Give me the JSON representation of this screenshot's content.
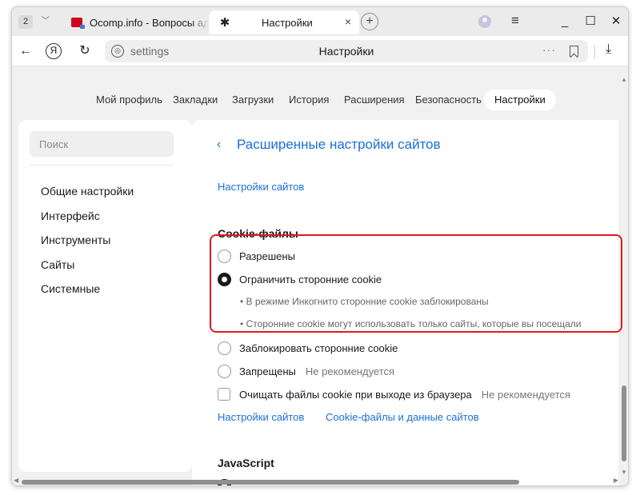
{
  "tabbar": {
    "tab_count": "2",
    "tabs": [
      {
        "title": "Ocomp.info - Вопросы адм",
        "active": false
      },
      {
        "title": "Настройки",
        "active": true
      }
    ],
    "new_tab_label": "+",
    "close_label": "×",
    "minimize_label": "_",
    "maximize_label": "☐",
    "window_close_label": "✕"
  },
  "address_bar": {
    "url": "settings",
    "page_title": "Настройки",
    "more_label": "···"
  },
  "nav_tabs": [
    "Мой профиль",
    "Закладки",
    "Загрузки",
    "История",
    "Расширения",
    "Безопасность",
    "Настройки"
  ],
  "active_nav_tab": "Настройки",
  "sidebar": {
    "search_placeholder": "Поиск",
    "items": [
      "Общие настройки",
      "Интерфейс",
      "Инструменты",
      "Сайты",
      "Системные"
    ]
  },
  "main": {
    "title": "Расширенные настройки сайтов",
    "top_link": "Настройки сайтов",
    "cookies": {
      "title": "Cookie-файлы",
      "options": [
        {
          "label": "Разрешены",
          "checked": false,
          "note": ""
        },
        {
          "label": "Ограничить сторонние cookie",
          "checked": true,
          "note": ""
        },
        {
          "label": "Заблокировать сторонние cookie",
          "checked": false,
          "note": ""
        },
        {
          "label": "Запрещены",
          "checked": false,
          "note": "Не рекомендуется"
        }
      ],
      "bullets": [
        "• В режиме Инкогнито сторонние cookie заблокированы",
        "• Сторонние cookie могут использовать только сайты, которые вы посещали"
      ],
      "clear_on_exit": {
        "label": "Очищать файлы cookie при выходе из браузера",
        "note": "Не рекомендуется",
        "checked": false
      },
      "links": [
        "Настройки сайтов",
        "Cookie-файлы и данные сайтов"
      ]
    },
    "javascript": {
      "title": "JavaScript"
    }
  },
  "colors": {
    "link": "#1a6fd8",
    "highlight": "#e0191f",
    "background": "#f1f1f1"
  }
}
